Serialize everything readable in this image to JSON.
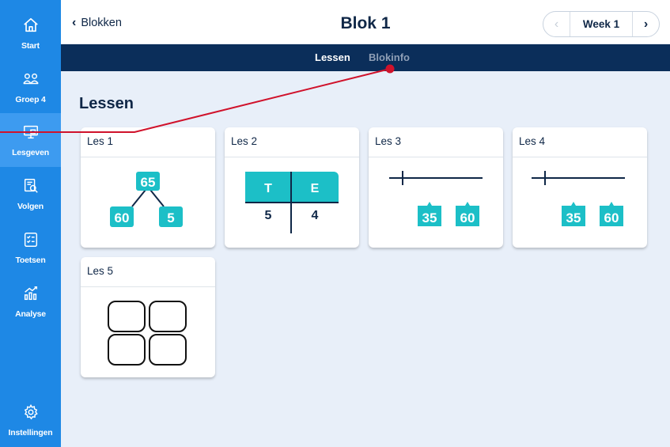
{
  "sidebar": {
    "items": [
      {
        "label": "Start",
        "icon": "home-icon"
      },
      {
        "label": "Groep 4",
        "icon": "group-icon"
      },
      {
        "label": "Lesgeven",
        "icon": "teach-icon",
        "active": true
      },
      {
        "label": "Volgen",
        "icon": "monitor-icon"
      },
      {
        "label": "Toetsen",
        "icon": "test-icon"
      },
      {
        "label": "Analyse",
        "icon": "analysis-icon"
      }
    ],
    "settings": {
      "label": "Instellingen",
      "icon": "gear-icon"
    }
  },
  "header": {
    "back_label": "Blokken",
    "title": "Blok 1",
    "week_label": "Week 1"
  },
  "subnav": {
    "tabs": [
      {
        "label": "Lessen",
        "active": true
      },
      {
        "label": "Blokinfo",
        "active": false
      }
    ]
  },
  "main": {
    "section_title": "Lessen",
    "lessons": [
      {
        "title": "Les 1",
        "visual": "number-split",
        "values": [
          "65",
          "60",
          "5"
        ]
      },
      {
        "title": "Les 2",
        "visual": "place-value-table",
        "headers": [
          "T",
          "E"
        ],
        "values": [
          "5",
          "4"
        ]
      },
      {
        "title": "Les 3",
        "visual": "number-line",
        "values": [
          "35",
          "60"
        ]
      },
      {
        "title": "Les 4",
        "visual": "number-line",
        "values": [
          "35",
          "60"
        ]
      },
      {
        "title": "Les 5",
        "visual": "four-boxes"
      }
    ]
  },
  "colors": {
    "sidebar": "#1e88e5",
    "sidebar_active": "#3d9bf0",
    "subnav": "#0b2e5a",
    "teal": "#1cbfc7",
    "background": "#e8eff9",
    "annotation": "#d0122b"
  }
}
